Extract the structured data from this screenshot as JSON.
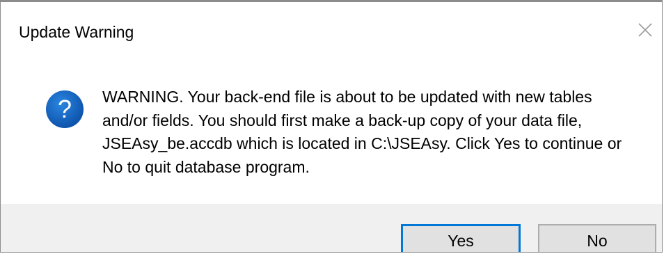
{
  "dialog": {
    "title": "Update Warning",
    "close_glyph": "✕",
    "icon": "question-icon",
    "icon_color": "#0b5fbc",
    "message": "WARNING. Your back-end file is about to be updated with new tables\nand/or fields. You should first make a back-up copy of your data file,\nJSEAsy_be.accdb which is located in C:\\JSEAsy.  Click Yes to continue or\nNo to quit database program.",
    "buttons": {
      "yes_label": "Yes",
      "no_label": "No"
    },
    "accent_color": "#0078d7"
  }
}
